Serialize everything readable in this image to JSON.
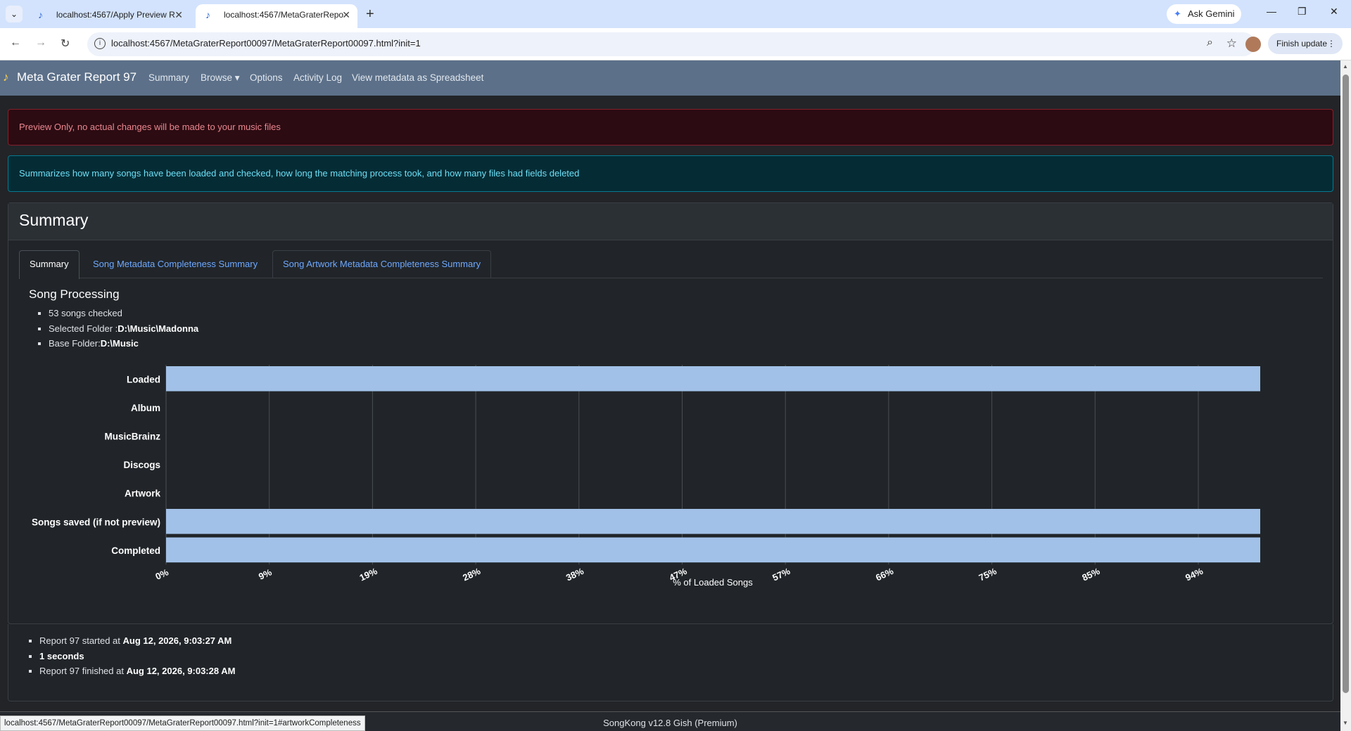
{
  "browser": {
    "tabs": [
      {
        "title": "localhost:4567/Apply Preview R",
        "active": false
      },
      {
        "title": "localhost:4567/MetaGraterRepo",
        "active": true
      }
    ],
    "ask_gemini": "Ask Gemini",
    "url": "localhost:4567/MetaGraterReport00097/MetaGraterReport00097.html?init=1",
    "finish_update": "Finish update",
    "status_url": "localhost:4567/MetaGraterReport00097/MetaGraterReport00097.html?init=1#artworkCompleteness"
  },
  "navbar": {
    "brand": "Meta Grater Report 97",
    "links": [
      "Summary",
      "Browse ▾",
      "Options",
      "Activity Log",
      "View metadata as Spreadsheet"
    ]
  },
  "alerts": {
    "preview": "Preview Only, no actual changes will be made to your music files",
    "info": "Summarizes how many songs have been loaded and checked, how long the matching process took, and how many files had fields deleted"
  },
  "card": {
    "title": "Summary",
    "tabs": [
      "Summary",
      "Song Metadata Completeness Summary",
      "Song Artwork Metadata Completeness Summary"
    ],
    "section_title": "Song Processing",
    "items": [
      {
        "text": "53 songs checked",
        "bold": ""
      },
      {
        "text": "Selected Folder :",
        "bold": "D:\\Music\\Madonna"
      },
      {
        "text": "Base Folder:",
        "bold": "D:\\Music"
      }
    ]
  },
  "chart_data": {
    "type": "bar",
    "orientation": "horizontal",
    "categories": [
      "Loaded",
      "Album",
      "MusicBrainz",
      "Discogs",
      "Artwork",
      "Songs saved (if not preview)",
      "Completed"
    ],
    "values": [
      100,
      0,
      0,
      0,
      0,
      100,
      100
    ],
    "xlabel": "% of Loaded Songs",
    "xticks": [
      "0%",
      "9%",
      "19%",
      "28%",
      "38%",
      "47%",
      "57%",
      "66%",
      "75%",
      "85%",
      "94%"
    ],
    "xlim": [
      0,
      100
    ],
    "grid": true,
    "bar_color": "#a2c1e8"
  },
  "report": {
    "items": [
      {
        "text": "Report 97 started at ",
        "bold": "Aug 12, 2026, 9:03:27 AM"
      },
      {
        "text": "",
        "bold": "1 seconds"
      },
      {
        "text": "Report 97 finished at ",
        "bold": "Aug 12, 2026, 9:03:28 AM"
      }
    ]
  },
  "footer": "SongKong v12.8 Gish (Premium)"
}
